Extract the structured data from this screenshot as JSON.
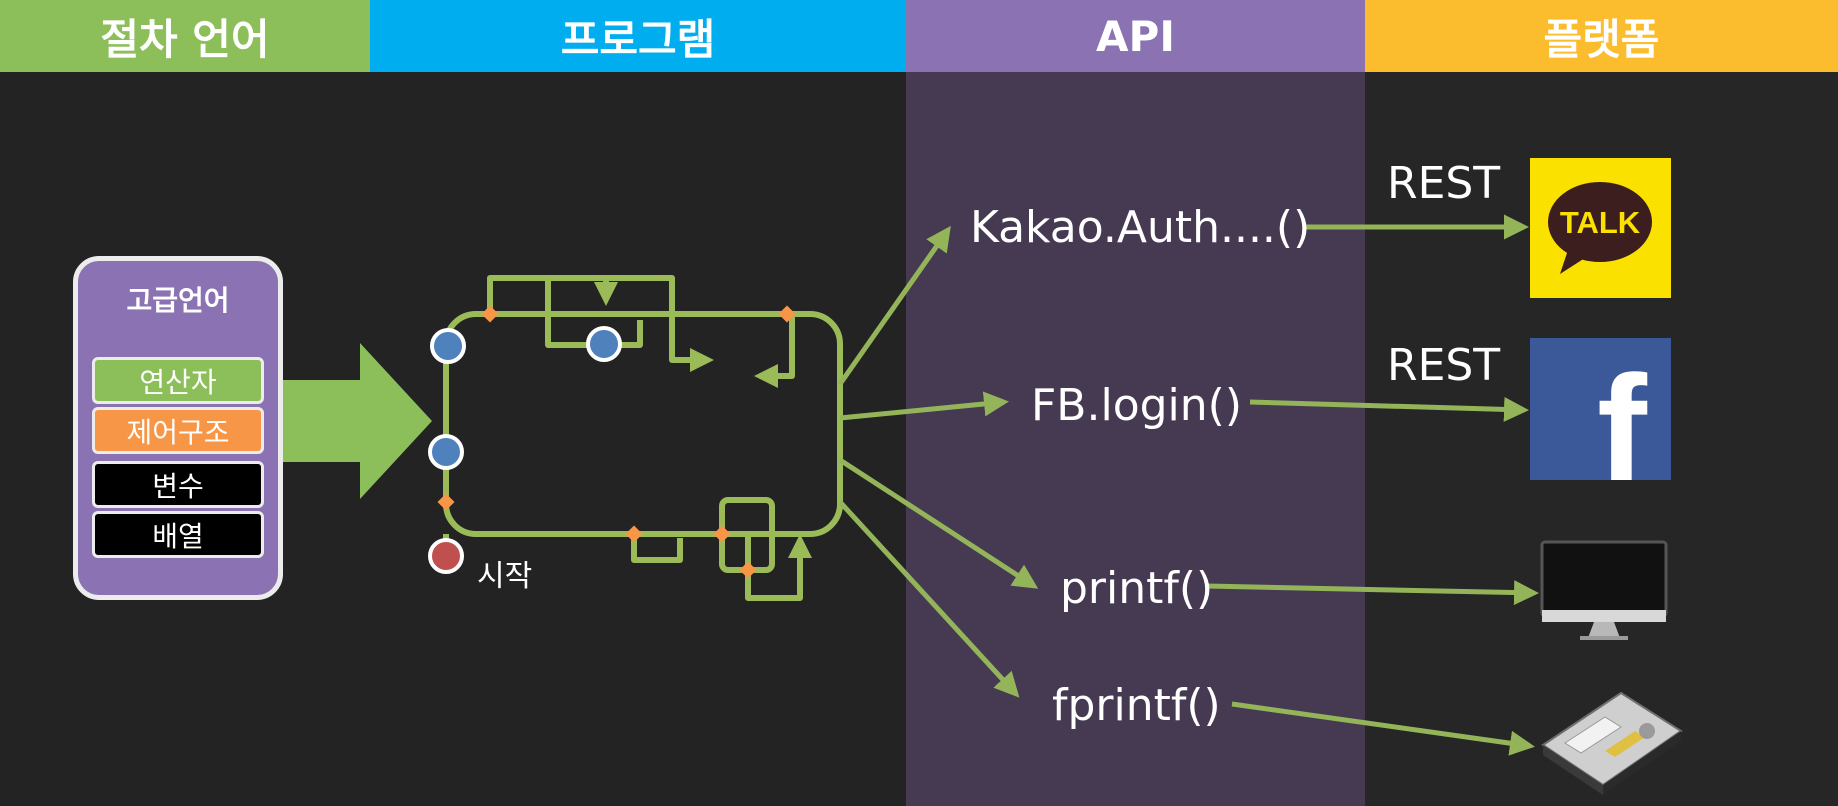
{
  "headers": {
    "procedural": "절차 언어",
    "program": "프로그램",
    "api": "API",
    "platform": "플랫폼"
  },
  "language_box": {
    "title": "고급언어",
    "items": [
      {
        "label": "연산자",
        "color": "#8cbf5a"
      },
      {
        "label": "제어구조",
        "color": "#f79646"
      },
      {
        "label": "변수",
        "color": "#000000"
      },
      {
        "label": "배열",
        "color": "#000000"
      }
    ]
  },
  "program_flow": {
    "start_label": "시작"
  },
  "api_calls": {
    "kakao": "Kakao.Auth....()",
    "facebook": "FB.login()",
    "printf": "printf()",
    "fprintf": "fprintf()"
  },
  "platform": {
    "rest_kakao": "REST",
    "rest_facebook": "REST",
    "kakao_logo_text": "TALK",
    "facebook_logo_text": "f",
    "icons": [
      "kakaotalk-icon",
      "facebook-icon",
      "monitor-icon",
      "hard-disk-icon"
    ]
  },
  "colors": {
    "flow_line": "#9bbb59",
    "arrow": "#94b45a",
    "node_blue": "#4f81bd",
    "node_red": "#c0504d",
    "marker_orange": "#f79646"
  }
}
